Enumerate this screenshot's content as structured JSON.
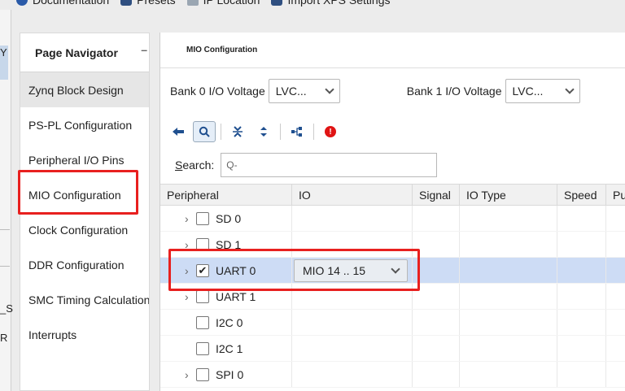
{
  "toolbar": {
    "items": [
      "Documentation",
      "Presets",
      "IP Location",
      "Import XPS Settings"
    ]
  },
  "left_sliver": {
    "texts": [
      "Y",
      "_S",
      "R"
    ]
  },
  "navigator": {
    "title": "Page Navigator",
    "minimize": "–",
    "items": [
      "Zynq Block Design",
      "PS-PL Configuration",
      "Peripheral I/O Pins",
      "MIO Configuration",
      "Clock Configuration",
      "DDR Configuration",
      "SMC Timing Calculation",
      "Interrupts"
    ],
    "selected": "Zynq Block Design"
  },
  "main": {
    "title": "MIO Configuration",
    "bank0": {
      "label": "Bank 0 I/O Voltage",
      "value": "LVC..."
    },
    "bank1": {
      "label": "Bank 1 I/O Voltage",
      "value": "LVC..."
    },
    "search": {
      "label_prefix": "S",
      "label_rest": "earch:",
      "placeholder": "Q-"
    },
    "columns": [
      "Peripheral",
      "IO",
      "Signal",
      "IO Type",
      "Speed",
      "Pu"
    ],
    "rows": [
      {
        "name": "SD 0",
        "expandable": true,
        "checked": false,
        "io": ""
      },
      {
        "name": "SD 1",
        "expandable": true,
        "checked": false,
        "io": ""
      },
      {
        "name": "UART 0",
        "expandable": true,
        "checked": true,
        "io": "MIO 14 .. 15"
      },
      {
        "name": "UART 1",
        "expandable": true,
        "checked": false,
        "io": ""
      },
      {
        "name": "I2C 0",
        "expandable": false,
        "checked": false,
        "io": ""
      },
      {
        "name": "I2C 1",
        "expandable": false,
        "checked": false,
        "io": ""
      },
      {
        "name": "SPI 0",
        "expandable": true,
        "checked": false,
        "io": ""
      }
    ],
    "check_glyph": "✔",
    "expand_glyph": "›",
    "error_glyph": "!"
  },
  "colors": {
    "highlight_box": "#e8201f",
    "selected_row": "#cddcf5",
    "accent": "#1f4f8f"
  }
}
